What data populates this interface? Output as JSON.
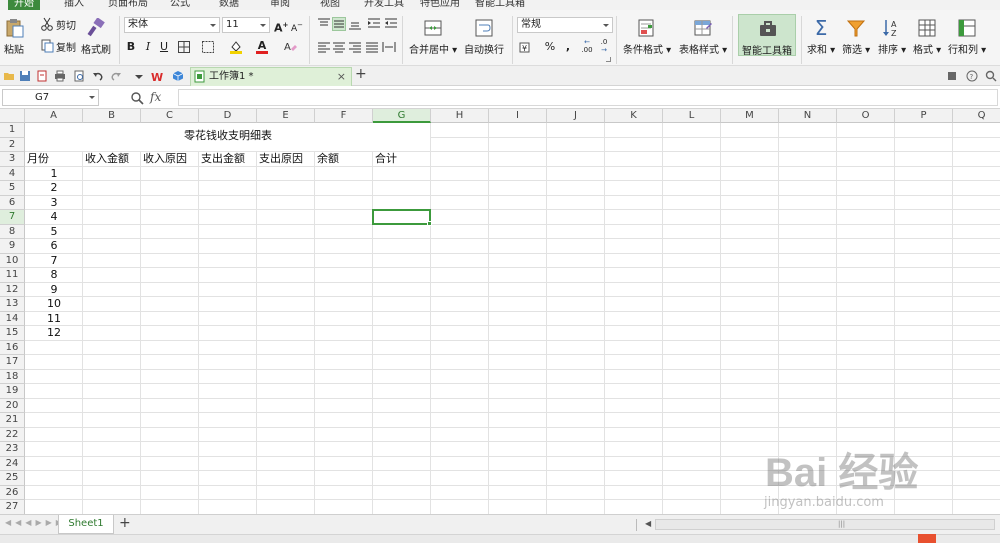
{
  "menu": {
    "tabs": [
      "开始",
      "插入",
      "页面布局",
      "公式",
      "数据",
      "审阅",
      "视图",
      "开发工具",
      "特色应用",
      "智能工具箱"
    ]
  },
  "ribbon": {
    "paste": "粘贴",
    "cut": "剪切",
    "copy": "复制",
    "format_painter": "格式刷",
    "font_name": "宋体",
    "font_size": "11",
    "bold": "B",
    "italic": "I",
    "underline": "U",
    "merge_center": "合并居中",
    "wrap_text": "自动换行",
    "number_format": "常规",
    "percent": "%",
    "thousands": ",",
    "dec_inc": ".00",
    "dec_dec": ".0",
    "conditional_format": "条件格式",
    "table_style": "表格样式",
    "smart_toolbox": "智能工具箱",
    "sum": "求和",
    "filter": "筛选",
    "sort": "排序",
    "format": "格式",
    "rows_cols": "行和列",
    "sum_glyph": "Σ"
  },
  "document": {
    "tab_title": "工作簿1 *",
    "close": "×",
    "new_tab": "+"
  },
  "formula_bar": {
    "name_box": "G7",
    "fx": "fx"
  },
  "grid": {
    "columns": [
      "A",
      "B",
      "C",
      "D",
      "E",
      "F",
      "G",
      "H",
      "I",
      "J",
      "K",
      "L",
      "M",
      "N",
      "O",
      "P",
      "Q"
    ],
    "rows": [
      "1",
      "2",
      "3",
      "4",
      "5",
      "6",
      "7",
      "8",
      "9",
      "10",
      "11",
      "12",
      "13",
      "14",
      "15",
      "16",
      "17",
      "18",
      "19",
      "20",
      "21",
      "22",
      "23",
      "24",
      "25",
      "26",
      "27"
    ],
    "selected_col": "G",
    "selected_row": "7",
    "title": "零花钱收支明细表",
    "headers": [
      "月份",
      "收入金额",
      "收入原因",
      "支出金额",
      "支出原因",
      "余额",
      "合计"
    ],
    "months": [
      "1",
      "2",
      "3",
      "4",
      "5",
      "6",
      "7",
      "8",
      "9",
      "10",
      "11",
      "12"
    ]
  },
  "sheets": {
    "active": "Sheet1",
    "add": "+"
  },
  "watermark": {
    "text": "Bai 经验",
    "url": "jingyan.baidu.com"
  },
  "colors": {
    "accent": "#3c9a3c",
    "selection_bg": "#dfeedd"
  }
}
